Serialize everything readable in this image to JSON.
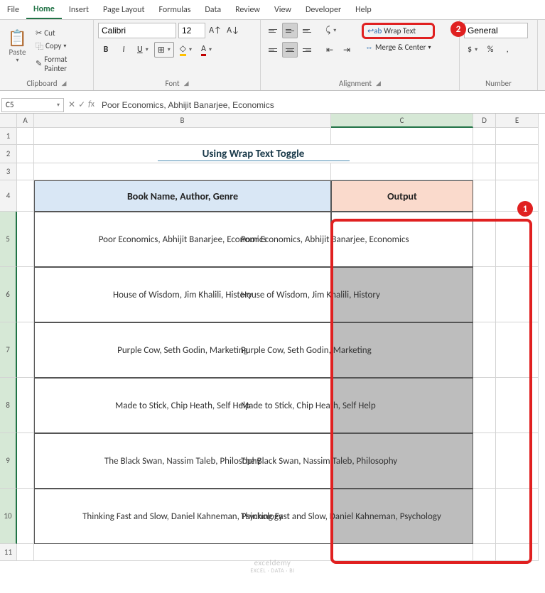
{
  "tabs": {
    "file": "File",
    "home": "Home",
    "insert": "Insert",
    "pageLayout": "Page Layout",
    "formulas": "Formulas",
    "data": "Data",
    "review": "Review",
    "view": "View",
    "developer": "Developer",
    "help": "Help"
  },
  "clipboard": {
    "paste": "Paste",
    "cut": "Cut",
    "copy": "Copy",
    "formatPainter": "Format Painter",
    "label": "Clipboard"
  },
  "font": {
    "name": "Calibri",
    "size": "12",
    "label": "Font"
  },
  "alignment": {
    "wrapText": "Wrap Text",
    "mergeCenter": "Merge & Center",
    "label": "Alignment"
  },
  "number": {
    "format": "General",
    "label": "Number"
  },
  "nameBox": "C5",
  "formulaBar": "Poor Economics, Abhijit Banarjee, Economics",
  "columns": {
    "A": "A",
    "B": "B",
    "C": "C",
    "D": "D",
    "E": "E"
  },
  "title": "Using Wrap Text Toggle",
  "headers": {
    "b": "Book Name, Author, Genre",
    "c": "Output"
  },
  "rows": [
    {
      "b": "Poor Economics, Abhijit Banarjee, Economics",
      "c": "Poor Economics, Abhijit Banarjee, Economics",
      "cVisible": "nomics, Abhijit Banarjee, Economics"
    },
    {
      "b": "House of Wisdom, Jim Khalili, History",
      "c": "House of Wisdom, Jim Khalili, History",
      "cVisible": "e of Wisdom, Jim Khalili, History"
    },
    {
      "b": "Purple Cow, Seth Godin, Marketing",
      "c": "Purple Cow, Seth Godin, Marketing",
      "cVisible": "le Cow, Seth Godin, Marketing"
    },
    {
      "b": "Made to Stick, Chip Heath, Self Help",
      "c": "Made to Stick, Chip Heath, Self Help",
      "cVisible": "e to Stick, Chip Heath, Self Help"
    },
    {
      "b": "The Black Swan, Nassim Taleb, Philosophy",
      "c": "The Black Swan, Nassim Taleb, Philosophy",
      "cVisible": "ck Swan, Nassim Taleb, Philosophy"
    },
    {
      "b": "Thinking Fast and Slow, Daniel Kahneman, Psychology",
      "c": "Thinking Fast and Slow, Daniel Kahneman, Psychology",
      "cVisible": "and Slow, Daniel Kahneman, Psychology"
    }
  ],
  "badges": {
    "one": "1",
    "two": "2"
  },
  "watermark": {
    "main": "exceldemy",
    "sub": "EXCEL · DATA · BI"
  }
}
